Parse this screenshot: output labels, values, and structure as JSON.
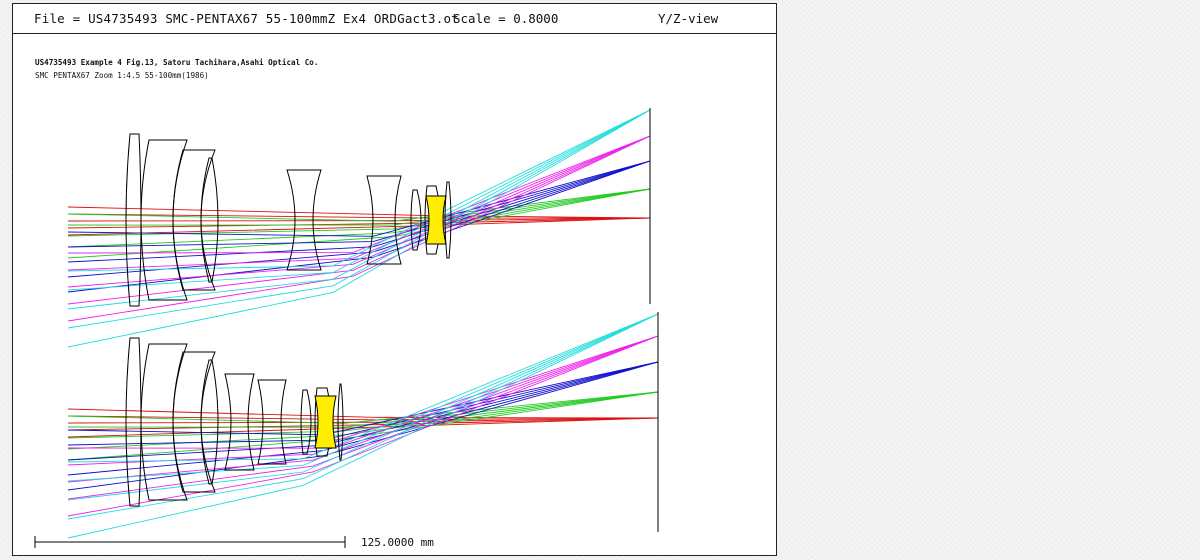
{
  "header": {
    "file_label": "File = US4735493 SMC-PENTAX67 55-100mmZ Ex4 ORDGact3.ot",
    "scale_label": "Scale = 0.8000",
    "view_label": "Y/Z-view"
  },
  "notes": {
    "line1": "US4735493 Example 4 Fig.13, Satoru Tachihara,Asahi Optical Co.",
    "line2": "SMC PENTAX67 Zoom 1:4.5 55-100mm(1986)"
  },
  "scale_bar": {
    "label": "125.0000 mm"
  },
  "colors": {
    "ray_axial": "#dd1111",
    "ray_field1": "#22cc22",
    "ray_field2": "#1111cc",
    "ray_field3": "#ee22ee",
    "ray_field4": "#22dddd",
    "lens_outline": "#000000",
    "highlight_fill": "#ffee00"
  }
}
